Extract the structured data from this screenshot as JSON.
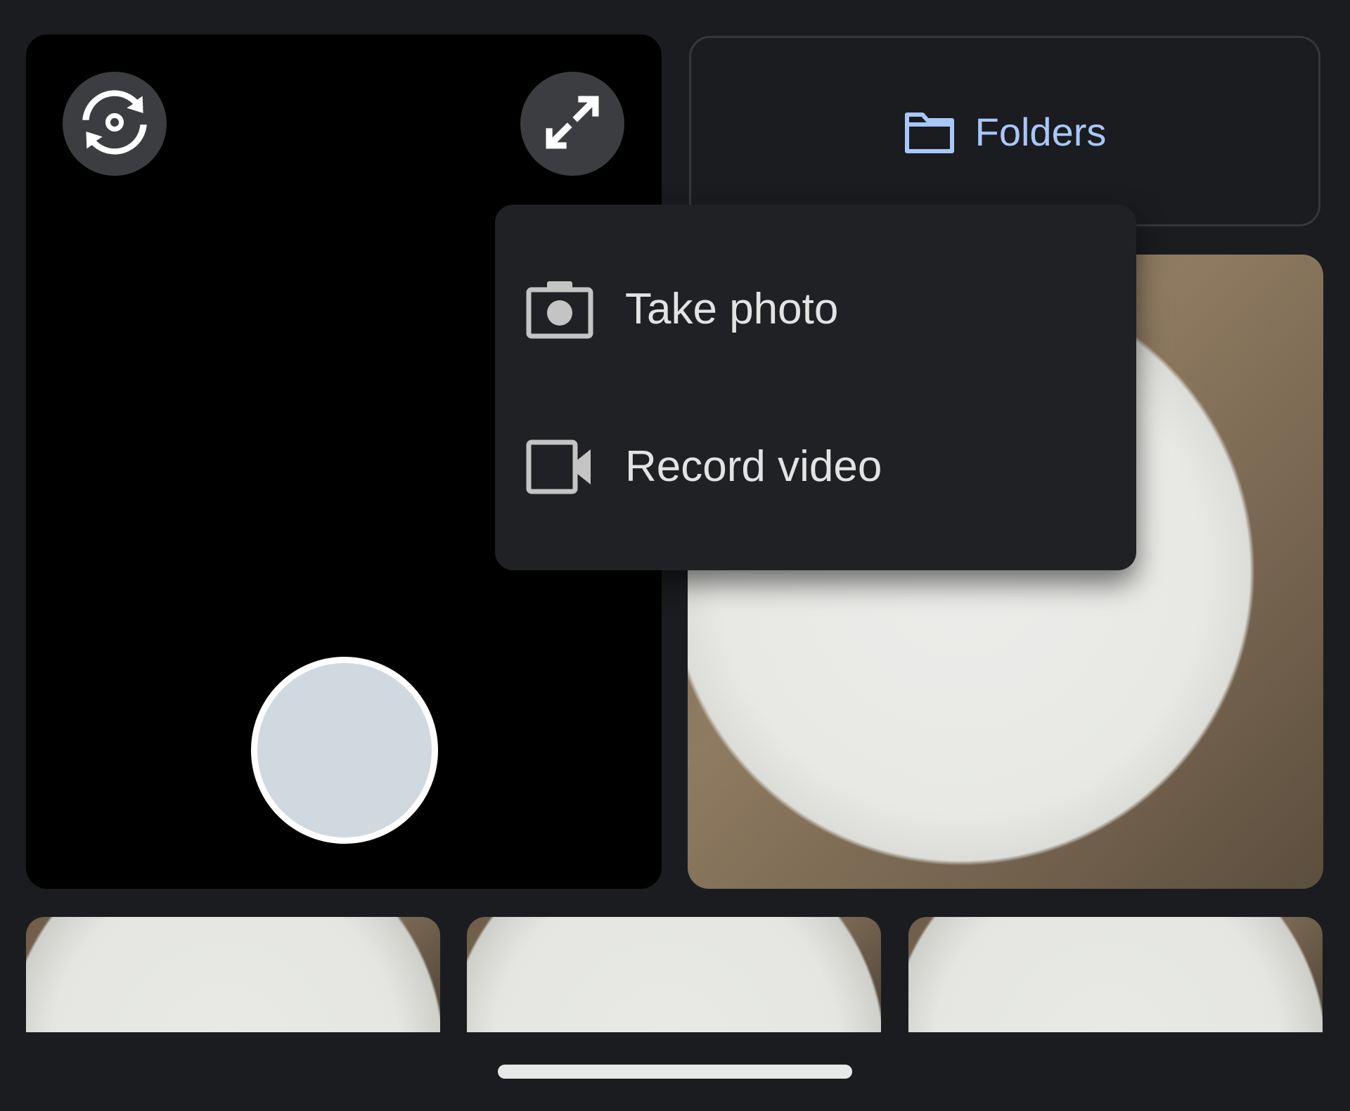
{
  "folders": {
    "label": "Folders",
    "icon": "folder-icon",
    "color": "#a8c7fa"
  },
  "camera": {
    "switch_icon": "switch-camera-icon",
    "expand_icon": "expand-icon",
    "shutter_color": "#d0d9e0"
  },
  "menu": {
    "items": [
      {
        "label": "Take photo",
        "icon": "camera-icon"
      },
      {
        "label": "Record video",
        "icon": "videocam-icon"
      }
    ]
  },
  "photos": {
    "count_visible": 4
  }
}
